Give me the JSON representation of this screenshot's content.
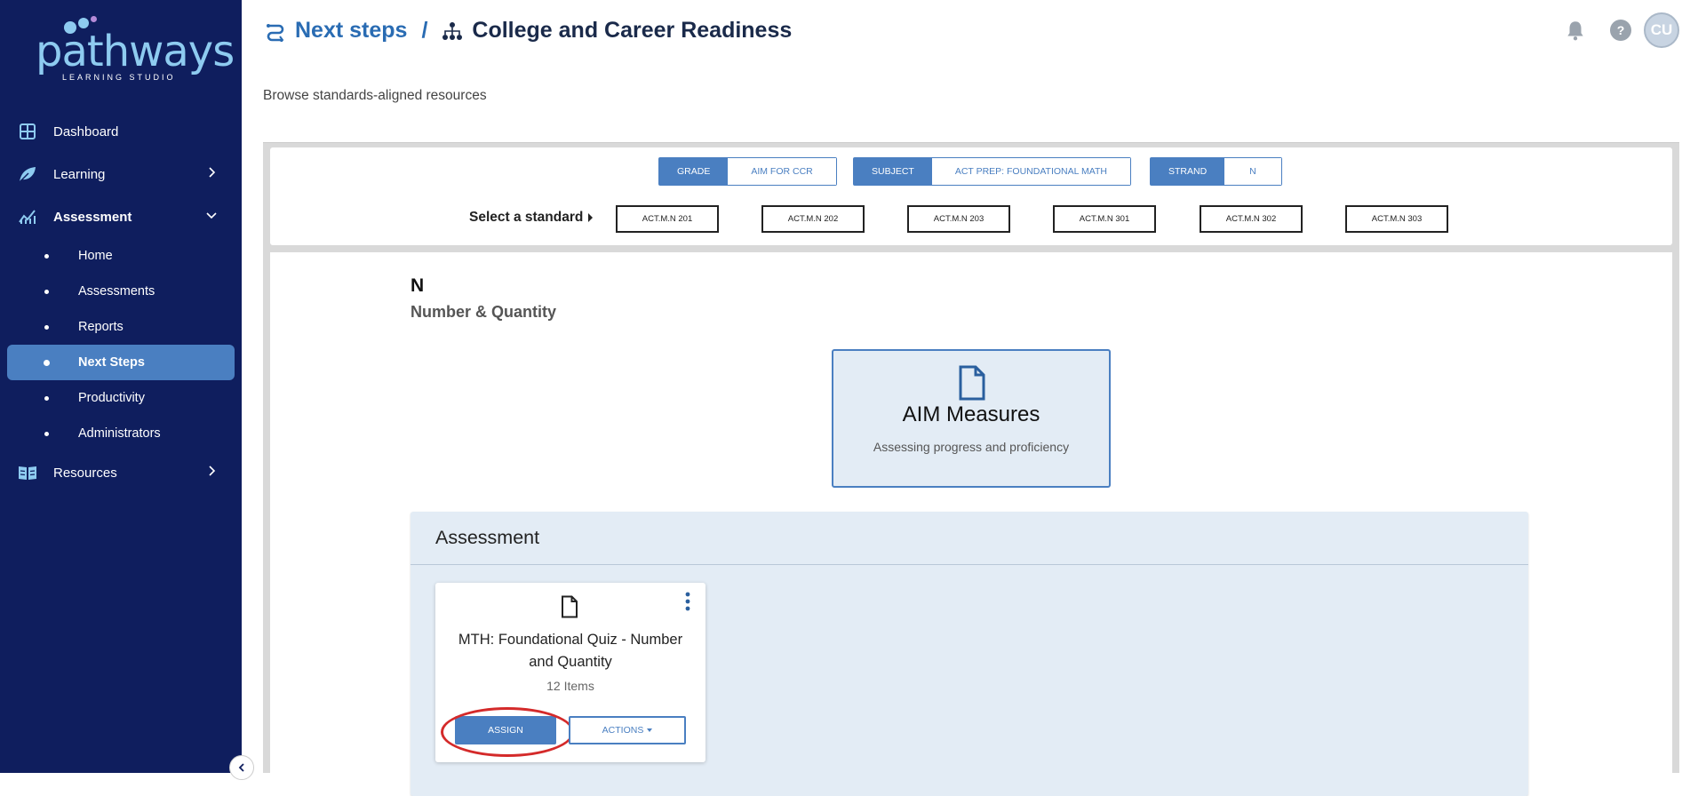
{
  "app": {
    "logo_text": "pathways",
    "logo_subtext": "LEARNING STUDIO"
  },
  "sidebar": {
    "items": [
      {
        "label": "Dashboard",
        "icon": "dashboard-grid-icon"
      },
      {
        "label": "Learning",
        "icon": "leaf-icon"
      },
      {
        "label": "Assessment",
        "icon": "chart-line-icon"
      },
      {
        "label": "Resources",
        "icon": "book-open-icon"
      }
    ],
    "assessment_sub": [
      {
        "label": "Home"
      },
      {
        "label": "Assessments"
      },
      {
        "label": "Reports"
      },
      {
        "label": "Next Steps"
      },
      {
        "label": "Productivity"
      },
      {
        "label": "Administrators"
      }
    ]
  },
  "header": {
    "breadcrumb_1": "Next steps",
    "separator": "/",
    "breadcrumb_2": "College and Career Readiness",
    "avatar_initials": "CU",
    "help_label": "?"
  },
  "page": {
    "subtitle": "Browse standards-aligned resources"
  },
  "filters": {
    "grade_key": "GRADE",
    "grade_value": "AIM FOR CCR",
    "subject_key": "SUBJECT",
    "subject_value": "ACT PREP: FOUNDATIONAL MATH",
    "strand_key": "STRAND",
    "strand_value": "N",
    "select_label": "Select a standard",
    "standards": [
      "ACT.M.N 201",
      "ACT.M.N 202",
      "ACT.M.N 203",
      "ACT.M.N 301",
      "ACT.M.N 302",
      "ACT.M.N 303"
    ]
  },
  "strand": {
    "code": "N",
    "name": "Number & Quantity"
  },
  "aim": {
    "title": "AIM Measures",
    "subtitle": "Assessing progress and proficiency"
  },
  "assessment": {
    "heading": "Assessment",
    "card": {
      "title": "MTH: Foundational Quiz - Number and Quantity",
      "items": "12 Items",
      "assign_label": "ASSIGN",
      "actions_label": "ACTIONS"
    }
  },
  "colors": {
    "sidebar_bg": "#0f1e5e",
    "accent": "#4a7fc1",
    "highlight_circle": "#d42a2a"
  }
}
